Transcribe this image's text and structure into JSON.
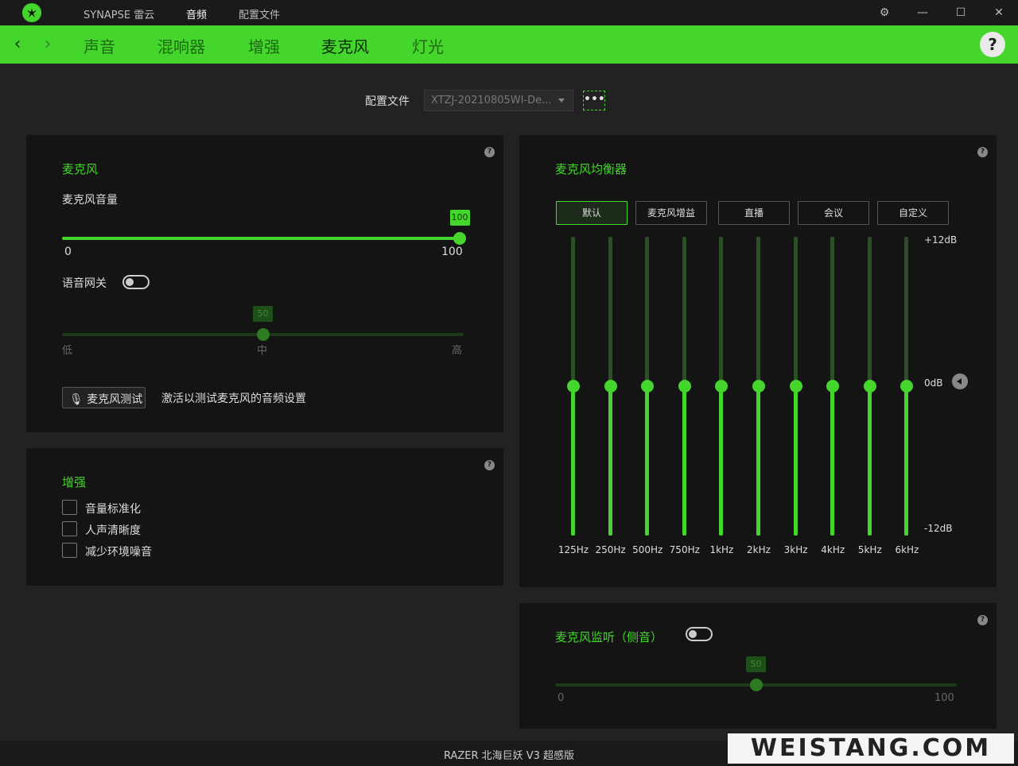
{
  "titlebar": {
    "brand": "SYNAPSE 雷云",
    "tabs": [
      "音频",
      "配置文件"
    ],
    "active_tab": "音频"
  },
  "nav": {
    "tabs": [
      "声音",
      "混响器",
      "增强",
      "麦克风",
      "灯光"
    ],
    "active": "麦克风",
    "help": "?"
  },
  "profile": {
    "label": "配置文件",
    "selected": "XTZJ-20210805WI-De...",
    "more": "•••"
  },
  "mic_panel": {
    "title": "麦克风",
    "volume_label": "麦克风音量",
    "volume_value": "100",
    "volume_level": 100,
    "volume_min": "0",
    "volume_max": "100",
    "gate_label": "语音网关",
    "gate_on": false,
    "gate_value": "50",
    "gate_level": 50,
    "gate_low": "低",
    "gate_mid": "中",
    "gate_high": "高",
    "test_button": "麦克风测试",
    "test_desc": "激活以测试麦克风的音频设置"
  },
  "enhance_panel": {
    "title": "增强",
    "options": [
      "音量标准化",
      "人声清晰度",
      "减少环境噪音"
    ]
  },
  "eq_panel": {
    "title": "麦克风均衡器",
    "presets": [
      "默认",
      "麦克风增益",
      "直播",
      "会议",
      "自定义"
    ],
    "active_preset": "默认",
    "db_top": "+12dB",
    "db_mid": "0dB",
    "db_bottom": "-12dB",
    "bands": [
      {
        "freq": "125Hz",
        "gain_db": 0
      },
      {
        "freq": "250Hz",
        "gain_db": 0
      },
      {
        "freq": "500Hz",
        "gain_db": 0
      },
      {
        "freq": "750Hz",
        "gain_db": 0
      },
      {
        "freq": "1kHz",
        "gain_db": 0
      },
      {
        "freq": "2kHz",
        "gain_db": 0
      },
      {
        "freq": "3kHz",
        "gain_db": 0
      },
      {
        "freq": "4kHz",
        "gain_db": 0
      },
      {
        "freq": "5kHz",
        "gain_db": 0
      },
      {
        "freq": "6kHz",
        "gain_db": 0
      }
    ]
  },
  "sidetone_panel": {
    "title": "麦克风监听（侧音）",
    "enabled": false,
    "value": "50",
    "level": 50,
    "min": "0",
    "max": "100"
  },
  "footer": {
    "device": "RAZER 北海巨妖 V3 超感版",
    "watermark": "WEISTANG.COM"
  },
  "colors": {
    "accent": "#44d62c",
    "background": "#222222",
    "panel": "#141414"
  }
}
